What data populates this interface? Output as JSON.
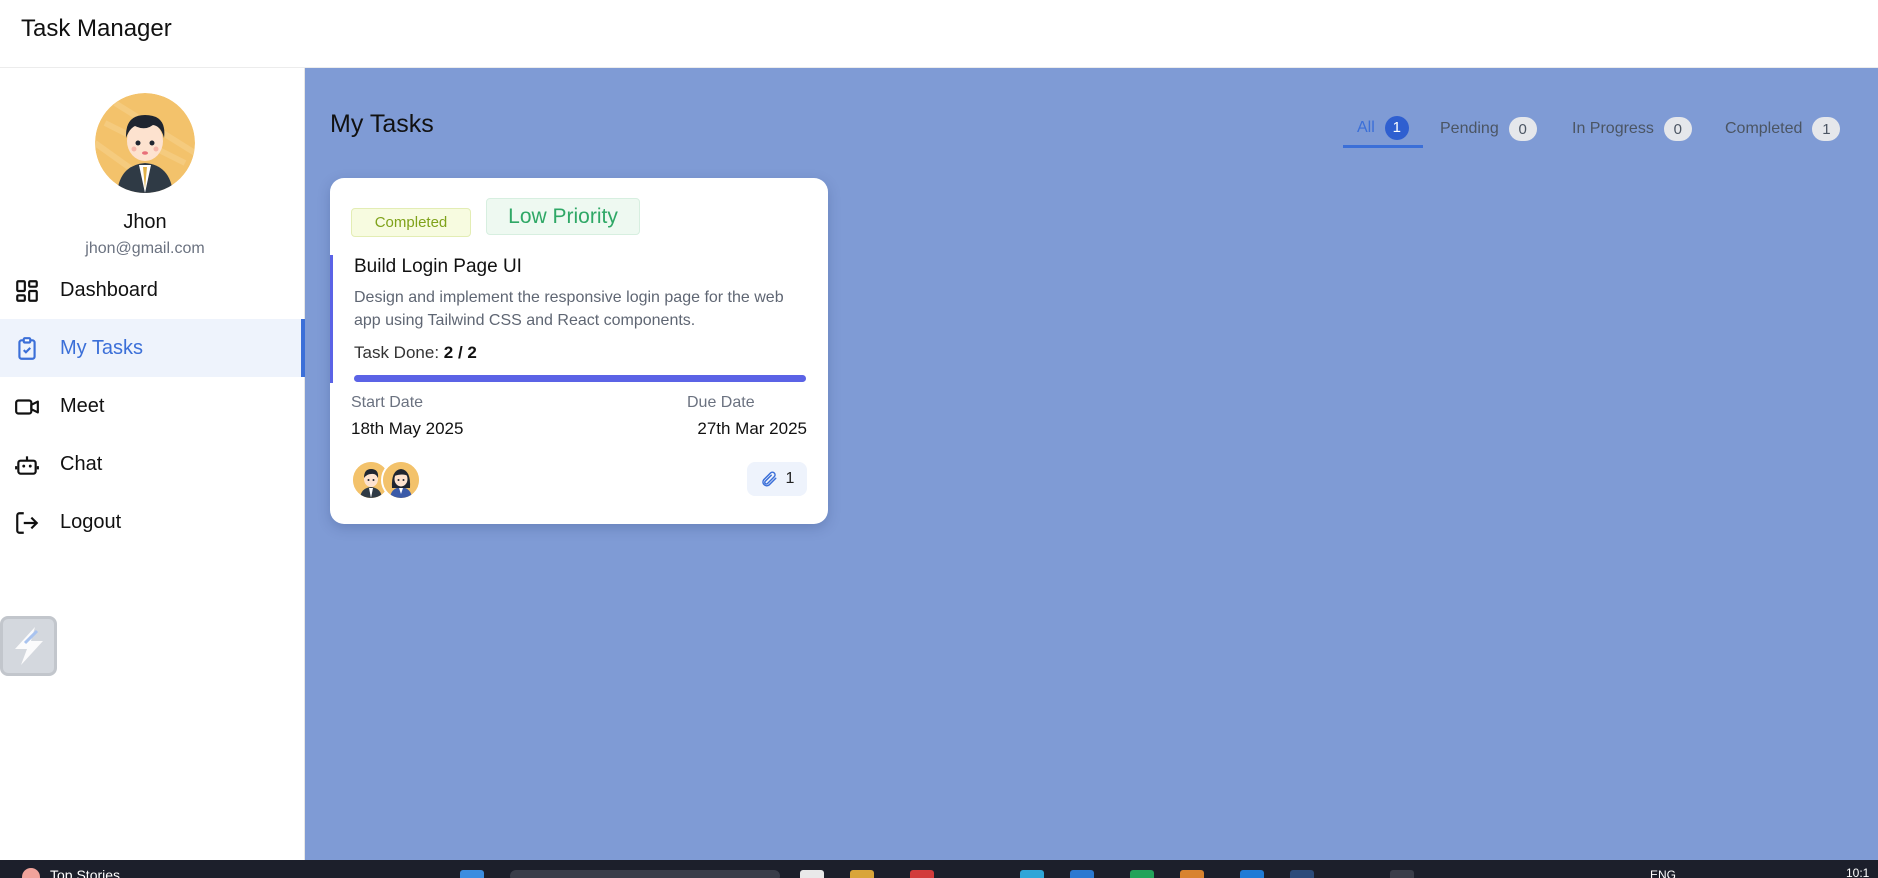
{
  "app": {
    "title": "Task Manager"
  },
  "user": {
    "name": "Jhon",
    "email": "jhon@gmail.com"
  },
  "sidebar": {
    "items": [
      {
        "label": "Dashboard",
        "icon": "grid-icon",
        "active": false
      },
      {
        "label": "My Tasks",
        "icon": "clipboard-check-icon",
        "active": true
      },
      {
        "label": "Meet",
        "icon": "video-camera-icon",
        "active": false
      },
      {
        "label": "Chat",
        "icon": "bot-icon",
        "active": false
      },
      {
        "label": "Logout",
        "icon": "logout-icon",
        "active": false
      }
    ]
  },
  "main": {
    "title": "My Tasks",
    "tabs": [
      {
        "label": "All",
        "count": "1",
        "active": true
      },
      {
        "label": "Pending",
        "count": "0",
        "active": false
      },
      {
        "label": "In Progress",
        "count": "0",
        "active": false
      },
      {
        "label": "Completed",
        "count": "1",
        "active": false
      }
    ]
  },
  "task": {
    "status": "Completed",
    "priority": "Low Priority",
    "title": "Build Login Page UI",
    "description": "Design and implement the responsive login page for the web app using Tailwind CSS and React components.",
    "done_label": "Task Done:",
    "done_value": "2 / 2",
    "progress": 1.0,
    "start_label": "Start Date",
    "start_date": "18th May 2025",
    "due_label": "Due Date",
    "due_date": "27th Mar 2025",
    "attachments": "1",
    "assignees": [
      "male-avatar",
      "female-avatar"
    ]
  },
  "taskbar": {
    "news": "Top Stories",
    "lang": "ENG",
    "time": "10:1"
  },
  "colors": {
    "accent": "#3b6fd8",
    "main_bg": "#7f9bd5",
    "progress": "#5b63e6",
    "status_completed": "#7fa21a",
    "priority_low": "#2fa866"
  }
}
